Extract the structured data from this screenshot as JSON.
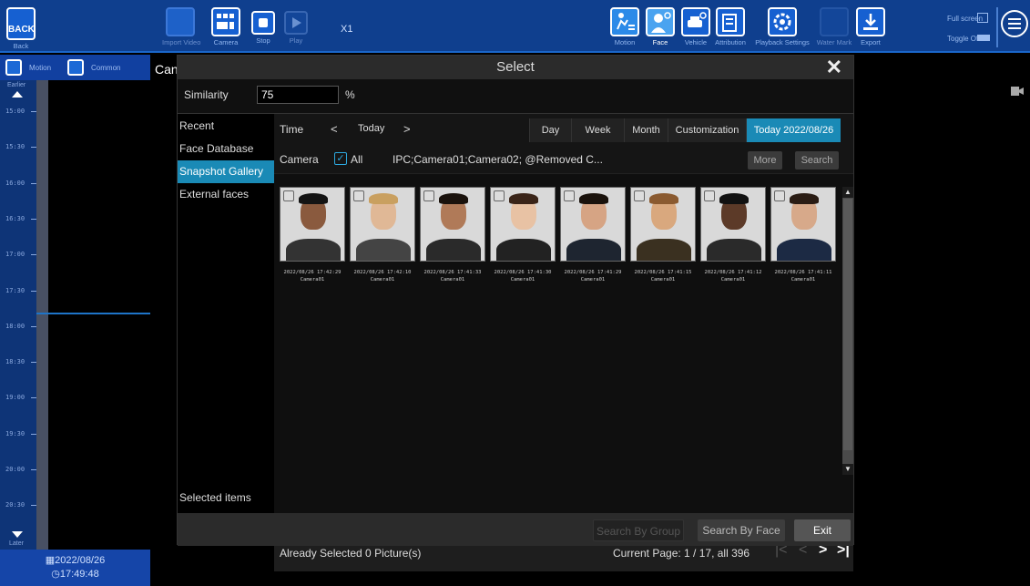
{
  "toolbar": {
    "back_label": "BACK",
    "back_sub": "Back",
    "items": [
      {
        "label": "Import Video"
      },
      {
        "label": "Camera"
      },
      {
        "label": "Stop"
      },
      {
        "label": "Play"
      }
    ],
    "speed": "X1",
    "right_items": [
      {
        "label": "Motion"
      },
      {
        "label": "Face"
      },
      {
        "label": "Vehicle"
      },
      {
        "label": "Attribution"
      },
      {
        "label": "Playback Settings"
      },
      {
        "label": "Water Mark"
      },
      {
        "label": "Export"
      }
    ],
    "full_screen": "Full screen",
    "toggle": "Toggle Of..."
  },
  "left": {
    "motion": "Motion",
    "common": "Common",
    "earlier": "Earlier",
    "later": "Later",
    "ticks": [
      "15:00",
      "15:30",
      "16:00",
      "16:30",
      "17:00",
      "17:30",
      "18:00",
      "18:30",
      "19:00",
      "19:30",
      "20:00",
      "20:30"
    ],
    "date": "2022/08/26",
    "time": "17:49:48"
  },
  "cam_label": "Can",
  "dialog": {
    "title": "Select",
    "similarity_label": "Similarity",
    "similarity_value": "75",
    "similarity_unit": "%",
    "side": [
      "Recent",
      "Face Database",
      "Snapshot Gallery",
      "External faces"
    ],
    "side_active": 2,
    "selected_items": "Selected items",
    "time_label": "Time",
    "prev": "<",
    "today": "Today",
    "next": ">",
    "segments": [
      "Day",
      "Week",
      "Month",
      "Customization",
      "Today 2022/08/26"
    ],
    "camera_label": "Camera",
    "all_label": "All",
    "camera_list": "IPC;Camera01;Camera02;  @Removed C...",
    "more": "More",
    "search": "Search",
    "snapshots": [
      {
        "time": "2022/08/26 17:42:29",
        "camera": "Camera01"
      },
      {
        "time": "2022/08/26 17:42:10",
        "camera": "Camera01"
      },
      {
        "time": "2022/08/26 17:41:33",
        "camera": "Camera01"
      },
      {
        "time": "2022/08/26 17:41:30",
        "camera": "Camera01"
      },
      {
        "time": "2022/08/26 17:41:29",
        "camera": "Camera01"
      },
      {
        "time": "2022/08/26 17:41:15",
        "camera": "Camera01"
      },
      {
        "time": "2022/08/26 17:41:12",
        "camera": "Camera01"
      },
      {
        "time": "2022/08/26 17:41:11",
        "camera": "Camera01"
      }
    ],
    "already_selected": "Already Selected 0 Picture(s)",
    "current_page": "Current Page: 1 / 17, all 396",
    "footer": {
      "search_by_group": "Search By Group",
      "search_by_face": "Search By Face",
      "exit": "Exit"
    }
  },
  "colors": {
    "toolbar_bg": "#0f3f8e",
    "accent": "#1a8ab6",
    "dialog_bg": "#1b1b1b"
  }
}
